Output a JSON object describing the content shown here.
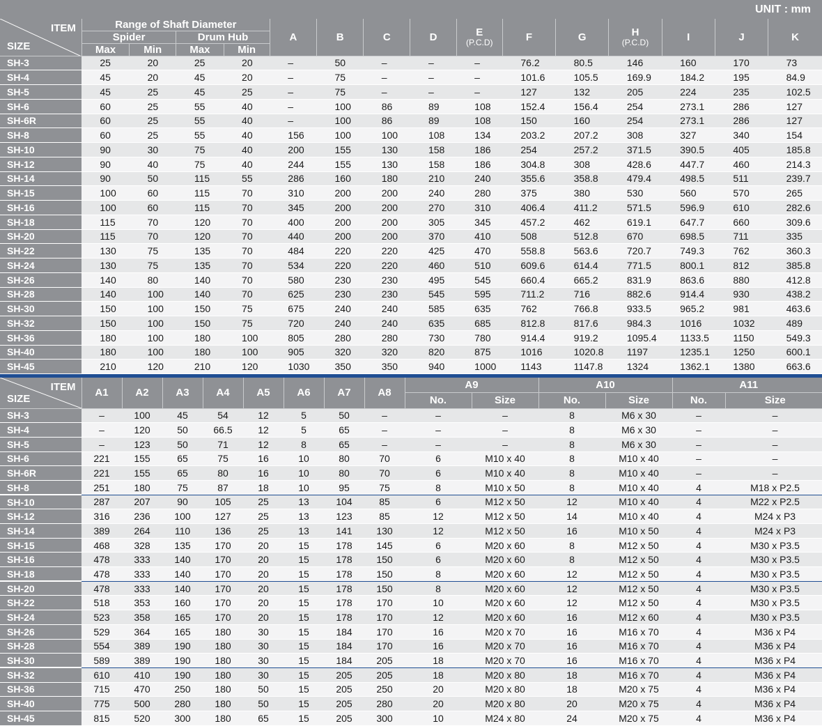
{
  "unit_label": "UNIT : mm",
  "table1": {
    "corner": {
      "item": "ITEM",
      "size": "SIZE"
    },
    "range_label": "Range of Shaft Diameter",
    "spider_label": "Spider",
    "drum_label": "Drum Hub",
    "max_label": "Max",
    "min_label": "Min",
    "cols": [
      {
        "label": "A",
        "sub": ""
      },
      {
        "label": "B",
        "sub": ""
      },
      {
        "label": "C",
        "sub": ""
      },
      {
        "label": "D",
        "sub": ""
      },
      {
        "label": "E",
        "sub": "(P.C.D)"
      },
      {
        "label": "F",
        "sub": ""
      },
      {
        "label": "G",
        "sub": ""
      },
      {
        "label": "H",
        "sub": "(P.C.D)"
      },
      {
        "label": "I",
        "sub": ""
      },
      {
        "label": "J",
        "sub": ""
      },
      {
        "label": "K",
        "sub": ""
      }
    ],
    "rows": [
      [
        "SH-3",
        "25",
        "20",
        "25",
        "20",
        "–",
        "50",
        "–",
        "–",
        "–",
        "76.2",
        "80.5",
        "146",
        "160",
        "170",
        "73"
      ],
      [
        "SH-4",
        "45",
        "20",
        "45",
        "20",
        "–",
        "75",
        "–",
        "–",
        "–",
        "101.6",
        "105.5",
        "169.9",
        "184.2",
        "195",
        "84.9"
      ],
      [
        "SH-5",
        "45",
        "25",
        "45",
        "25",
        "–",
        "75",
        "–",
        "–",
        "–",
        "127",
        "132",
        "205",
        "224",
        "235",
        "102.5"
      ],
      [
        "SH-6",
        "60",
        "25",
        "55",
        "40",
        "–",
        "100",
        "86",
        "89",
        "108",
        "152.4",
        "156.4",
        "254",
        "273.1",
        "286",
        "127"
      ],
      [
        "SH-6R",
        "60",
        "25",
        "55",
        "40",
        "–",
        "100",
        "86",
        "89",
        "108",
        "150",
        "160",
        "254",
        "273.1",
        "286",
        "127"
      ],
      [
        "SH-8",
        "60",
        "25",
        "55",
        "40",
        "156",
        "100",
        "100",
        "108",
        "134",
        "203.2",
        "207.2",
        "308",
        "327",
        "340",
        "154"
      ],
      [
        "SH-10",
        "90",
        "30",
        "75",
        "40",
        "200",
        "155",
        "130",
        "158",
        "186",
        "254",
        "257.2",
        "371.5",
        "390.5",
        "405",
        "185.8"
      ],
      [
        "SH-12",
        "90",
        "40",
        "75",
        "40",
        "244",
        "155",
        "130",
        "158",
        "186",
        "304.8",
        "308",
        "428.6",
        "447.7",
        "460",
        "214.3"
      ],
      [
        "SH-14",
        "90",
        "50",
        "115",
        "55",
        "286",
        "160",
        "180",
        "210",
        "240",
        "355.6",
        "358.8",
        "479.4",
        "498.5",
        "511",
        "239.7"
      ],
      [
        "SH-15",
        "100",
        "60",
        "115",
        "70",
        "310",
        "200",
        "200",
        "240",
        "280",
        "375",
        "380",
        "530",
        "560",
        "570",
        "265"
      ],
      [
        "SH-16",
        "100",
        "60",
        "115",
        "70",
        "345",
        "200",
        "200",
        "270",
        "310",
        "406.4",
        "411.2",
        "571.5",
        "596.9",
        "610",
        "282.6"
      ],
      [
        "SH-18",
        "115",
        "70",
        "120",
        "70",
        "400",
        "200",
        "200",
        "305",
        "345",
        "457.2",
        "462",
        "619.1",
        "647.7",
        "660",
        "309.6"
      ],
      [
        "SH-20",
        "115",
        "70",
        "120",
        "70",
        "440",
        "200",
        "200",
        "370",
        "410",
        "508",
        "512.8",
        "670",
        "698.5",
        "711",
        "335"
      ],
      [
        "SH-22",
        "130",
        "75",
        "135",
        "70",
        "484",
        "220",
        "220",
        "425",
        "470",
        "558.8",
        "563.6",
        "720.7",
        "749.3",
        "762",
        "360.3"
      ],
      [
        "SH-24",
        "130",
        "75",
        "135",
        "70",
        "534",
        "220",
        "220",
        "460",
        "510",
        "609.6",
        "614.4",
        "771.5",
        "800.1",
        "812",
        "385.8"
      ],
      [
        "SH-26",
        "140",
        "80",
        "140",
        "70",
        "580",
        "230",
        "230",
        "495",
        "545",
        "660.4",
        "665.2",
        "831.9",
        "863.6",
        "880",
        "412.8"
      ],
      [
        "SH-28",
        "140",
        "100",
        "140",
        "70",
        "625",
        "230",
        "230",
        "545",
        "595",
        "711.2",
        "716",
        "882.6",
        "914.4",
        "930",
        "438.2"
      ],
      [
        "SH-30",
        "150",
        "100",
        "150",
        "75",
        "675",
        "240",
        "240",
        "585",
        "635",
        "762",
        "766.8",
        "933.5",
        "965.2",
        "981",
        "463.6"
      ],
      [
        "SH-32",
        "150",
        "100",
        "150",
        "75",
        "720",
        "240",
        "240",
        "635",
        "685",
        "812.8",
        "817.6",
        "984.3",
        "1016",
        "1032",
        "489"
      ],
      [
        "SH-36",
        "180",
        "100",
        "180",
        "100",
        "805",
        "280",
        "280",
        "730",
        "780",
        "914.4",
        "919.2",
        "1095.4",
        "1133.5",
        "1150",
        "549.3"
      ],
      [
        "SH-40",
        "180",
        "100",
        "180",
        "100",
        "905",
        "320",
        "320",
        "820",
        "875",
        "1016",
        "1020.8",
        "1197",
        "1235.1",
        "1250",
        "600.1"
      ],
      [
        "SH-45",
        "210",
        "120",
        "210",
        "120",
        "1030",
        "350",
        "350",
        "940",
        "1000",
        "1143",
        "1147.8",
        "1324",
        "1362.1",
        "1380",
        "663.6"
      ]
    ]
  },
  "table2": {
    "corner": {
      "item": "ITEM",
      "size": "SIZE"
    },
    "cols": [
      "A1",
      "A2",
      "A3",
      "A4",
      "A5",
      "A6",
      "A7",
      "A8"
    ],
    "groups": [
      "A9",
      "A10",
      "A11"
    ],
    "no_label": "No.",
    "size_label": "Size",
    "rows": [
      [
        "SH-3",
        "–",
        "100",
        "45",
        "54",
        "12",
        "5",
        "50",
        "–",
        "–",
        "–",
        "8",
        "M6 x 30",
        "–",
        "–"
      ],
      [
        "SH-4",
        "–",
        "120",
        "50",
        "66.5",
        "12",
        "5",
        "65",
        "–",
        "–",
        "–",
        "8",
        "M6 x 30",
        "–",
        "–"
      ],
      [
        "SH-5",
        "–",
        "123",
        "50",
        "71",
        "12",
        "8",
        "65",
        "–",
        "–",
        "–",
        "8",
        "M6 x 30",
        "–",
        "–"
      ],
      [
        "SH-6",
        "221",
        "155",
        "65",
        "75",
        "16",
        "10",
        "80",
        "70",
        "6",
        "M10 x 40",
        "8",
        "M10 x 40",
        "–",
        "–"
      ],
      [
        "SH-6R",
        "221",
        "155",
        "65",
        "80",
        "16",
        "10",
        "80",
        "70",
        "6",
        "M10 x 40",
        "8",
        "M10 x 40",
        "–",
        "–"
      ],
      [
        "SH-8",
        "251",
        "180",
        "75",
        "87",
        "18",
        "10",
        "95",
        "75",
        "8",
        "M10 x 50",
        "8",
        "M10 x 40",
        "4",
        "M18 x P2.5"
      ],
      [
        "SH-10",
        "287",
        "207",
        "90",
        "105",
        "25",
        "13",
        "104",
        "85",
        "6",
        "M12 x 50",
        "12",
        "M10 x 40",
        "4",
        "M22 x P2.5"
      ],
      [
        "SH-12",
        "316",
        "236",
        "100",
        "127",
        "25",
        "13",
        "123",
        "85",
        "12",
        "M12 x 50",
        "14",
        "M10 x 40",
        "4",
        "M24 x P3"
      ],
      [
        "SH-14",
        "389",
        "264",
        "110",
        "136",
        "25",
        "13",
        "141",
        "130",
        "12",
        "M12 x 50",
        "16",
        "M10 x 50",
        "4",
        "M24 x P3"
      ],
      [
        "SH-15",
        "468",
        "328",
        "135",
        "170",
        "20",
        "15",
        "178",
        "145",
        "6",
        "M20 x 60",
        "8",
        "M12 x 50",
        "4",
        "M30 x P3.5"
      ],
      [
        "SH-16",
        "478",
        "333",
        "140",
        "170",
        "20",
        "15",
        "178",
        "150",
        "6",
        "M20 x 60",
        "8",
        "M12 x 50",
        "4",
        "M30 x P3.5"
      ],
      [
        "SH-18",
        "478",
        "333",
        "140",
        "170",
        "20",
        "15",
        "178",
        "150",
        "8",
        "M20 x 60",
        "12",
        "M12 x 50",
        "4",
        "M30 x P3.5"
      ],
      [
        "SH-20",
        "478",
        "333",
        "140",
        "170",
        "20",
        "15",
        "178",
        "150",
        "8",
        "M20 x 60",
        "12",
        "M12 x 50",
        "4",
        "M30 x P3.5"
      ],
      [
        "SH-22",
        "518",
        "353",
        "160",
        "170",
        "20",
        "15",
        "178",
        "170",
        "10",
        "M20 x 60",
        "12",
        "M12 x 50",
        "4",
        "M30 x P3.5"
      ],
      [
        "SH-24",
        "523",
        "358",
        "165",
        "170",
        "20",
        "15",
        "178",
        "170",
        "12",
        "M20 x 60",
        "16",
        "M12 x 60",
        "4",
        "M30 x P3.5"
      ],
      [
        "SH-26",
        "529",
        "364",
        "165",
        "180",
        "30",
        "15",
        "184",
        "170",
        "16",
        "M20 x 70",
        "16",
        "M16 x 70",
        "4",
        "M36 x P4"
      ],
      [
        "SH-28",
        "554",
        "389",
        "190",
        "180",
        "30",
        "15",
        "184",
        "170",
        "16",
        "M20 x 70",
        "16",
        "M16 x 70",
        "4",
        "M36 x P4"
      ],
      [
        "SH-30",
        "589",
        "389",
        "190",
        "180",
        "30",
        "15",
        "184",
        "205",
        "18",
        "M20 x 70",
        "16",
        "M16 x 70",
        "4",
        "M36 x P4"
      ],
      [
        "SH-32",
        "610",
        "410",
        "190",
        "180",
        "30",
        "15",
        "205",
        "205",
        "18",
        "M20 x 80",
        "18",
        "M16 x 70",
        "4",
        "M36 x P4"
      ],
      [
        "SH-36",
        "715",
        "470",
        "250",
        "180",
        "50",
        "15",
        "205",
        "250",
        "20",
        "M20 x 80",
        "18",
        "M20 x 75",
        "4",
        "M36 x P4"
      ],
      [
        "SH-40",
        "775",
        "500",
        "280",
        "180",
        "50",
        "15",
        "205",
        "280",
        "20",
        "M20 x 80",
        "20",
        "M20 x 75",
        "4",
        "M36 x P4"
      ],
      [
        "SH-45",
        "815",
        "520",
        "300",
        "180",
        "65",
        "15",
        "205",
        "300",
        "10",
        "M24 x 80",
        "24",
        "M20 x 75",
        "4",
        "M36 x P4"
      ]
    ]
  }
}
